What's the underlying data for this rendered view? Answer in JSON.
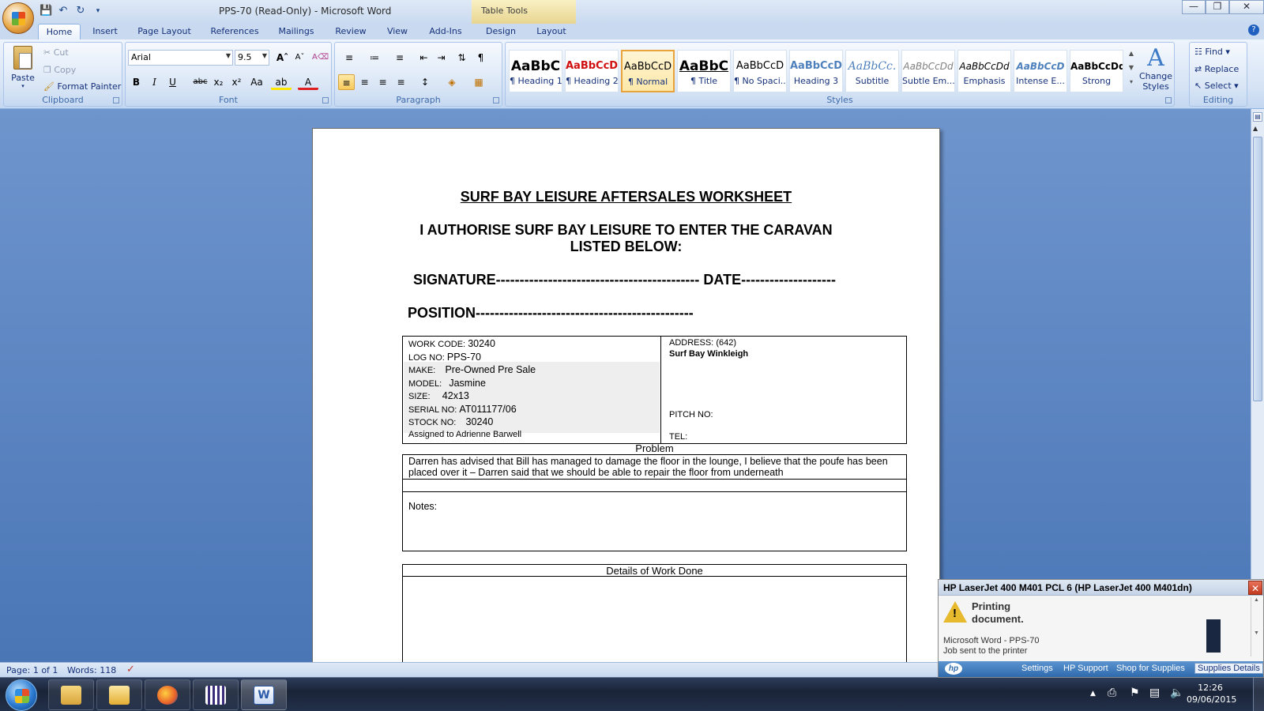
{
  "window": {
    "title": "PPS-70 (Read-Only) - Microsoft Word",
    "contextual_tab": "Table Tools"
  },
  "tabs": [
    "Home",
    "Insert",
    "Page Layout",
    "References",
    "Mailings",
    "Review",
    "View",
    "Add-Ins",
    "Design",
    "Layout"
  ],
  "ribbon": {
    "clipboard": {
      "label": "Clipboard",
      "paste": "Paste",
      "cut": "Cut",
      "copy": "Copy",
      "format_painter": "Format Painter"
    },
    "font": {
      "label": "Font",
      "family": "Arial",
      "size": "9.5"
    },
    "paragraph": {
      "label": "Paragraph"
    },
    "styles": {
      "label": "Styles",
      "items": [
        {
          "preview": "AaBbC",
          "name": "¶ Heading 1"
        },
        {
          "preview": "AaBbCcDd",
          "name": "¶ Heading 2"
        },
        {
          "preview": "AaBbCcD",
          "name": "¶ Normal"
        },
        {
          "preview": "AaBbC",
          "name": "¶ Title"
        },
        {
          "preview": "AaBbCcD",
          "name": "¶ No Spaci..."
        },
        {
          "preview": "AaBbCcDd",
          "name": "Heading 3"
        },
        {
          "preview": "AaBbCc.",
          "name": "Subtitle"
        },
        {
          "preview": "AaBbCcDd",
          "name": "Subtle Em..."
        },
        {
          "preview": "AaBbCcDd",
          "name": "Emphasis"
        },
        {
          "preview": "AaBbCcD",
          "name": "Intense E..."
        },
        {
          "preview": "AaBbCcDd",
          "name": "Strong"
        }
      ],
      "change_styles": "Change Styles"
    },
    "editing": {
      "label": "Editing",
      "find": "Find",
      "replace": "Replace",
      "select": "Select"
    }
  },
  "document": {
    "title": "SURF BAY LEISURE AFTERSALES WORKSHEET",
    "authorise_line1": "I AUTHORISE SURF BAY LEISURE TO ENTER THE CARAVAN",
    "authorise_line2": "LISTED BELOW:",
    "signature_line": "SIGNATURE------------------------------------------- DATE--------------------",
    "position_line": "POSITION----------------------------------------------",
    "work_code_label": "WORK CODE:",
    "work_code": "30240",
    "log_no_label": "LOG NO:",
    "log_no": "PPS-70",
    "make_label": "MAKE:",
    "make": "Pre-Owned Pre Sale",
    "model_label": "MODEL:",
    "model": "Jasmine",
    "size_label": "SIZE:",
    "size": "42x13",
    "serial_label": "SERIAL NO:",
    "serial": "AT011177/06",
    "stock_label": "STOCK NO:",
    "stock": "30240",
    "assigned": "Assigned to Adrienne Barwell",
    "address_label": "ADDRESS:",
    "address_code": "(642)",
    "address_name": "Surf Bay Winkleigh",
    "pitch_label": "PITCH NO:",
    "tel_label": "TEL:",
    "problem_label": "Problem",
    "problem_text": "Darren has advised that Bill has managed to damage the floor in the lounge, I believe that the poufe has been placed over it – Darren said that we should be able to repair the floor from underneath",
    "notes_label": "Notes:",
    "work_done_label": "Details of Work Done"
  },
  "status": {
    "page": "Page: 1 of 1",
    "words": "Words: 118"
  },
  "print_popup": {
    "title": "HP LaserJet 400 M401 PCL 6 (HP LaserJet 400 M401dn)",
    "message_line1": "Printing",
    "message_line2": "document.",
    "info_line1": "Microsoft Word - PPS-70",
    "info_line2": "Job sent to the printer",
    "links": [
      "Settings",
      "HP Support",
      "Shop for Supplies",
      "Supplies Details"
    ]
  },
  "taskbar": {
    "time": "12:26",
    "date": "09/06/2015"
  }
}
